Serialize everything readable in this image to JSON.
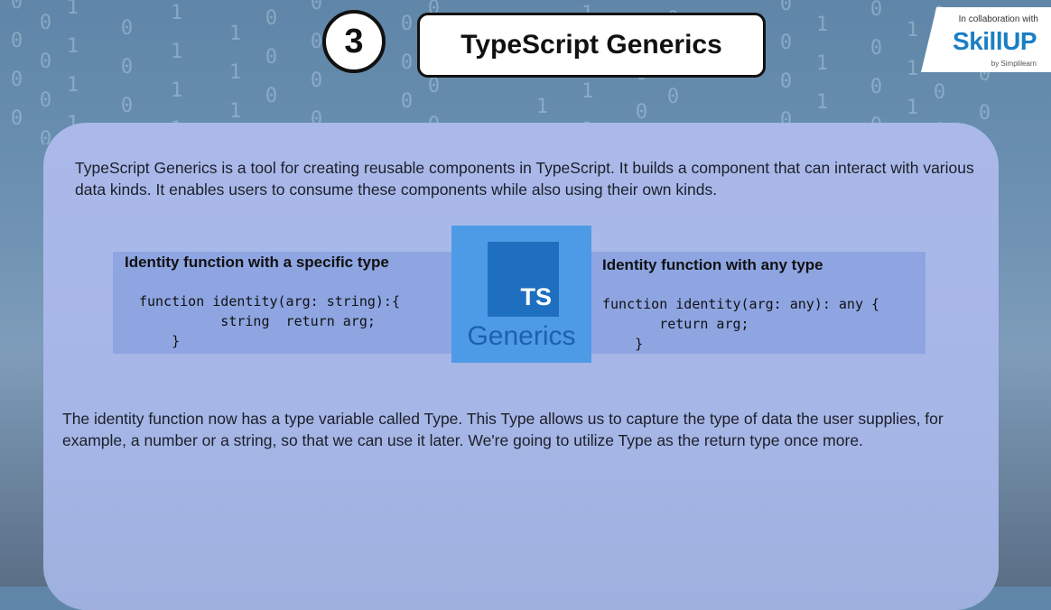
{
  "header": {
    "step_number": "3",
    "title": "TypeScript Generics"
  },
  "branding": {
    "collab_text": "In collaboration with",
    "logo_text": "SkillUP",
    "byline": "by Simplilearn"
  },
  "content": {
    "intro": "TypeScript Generics is a tool for creating reusable components in TypeScript. It builds a component that can interact with various data kinds. It enables users to consume these components while also using their own kinds.",
    "left_box": {
      "heading": "Identity function with a specific type",
      "code": "function identity(arg: string):{\n          string  return arg;\n    }"
    },
    "right_box": {
      "heading": "Identity function with any type",
      "code": "function identity(arg: any): any {\n       return arg;\n    }"
    },
    "ts_logo": {
      "badge": "TS",
      "word": "Generics"
    },
    "outro": "The identity function now has a type variable called Type. This Type allows us to capture the type of data the user supplies, for example, a number or a string, so that we can use it later. We're going to utilize Type as the return type once more."
  },
  "colors": {
    "card": "#a6b6e6",
    "code_box": "#8ea5e2",
    "ts_light": "#4d9be6",
    "ts_dark": "#1f6fc1"
  }
}
